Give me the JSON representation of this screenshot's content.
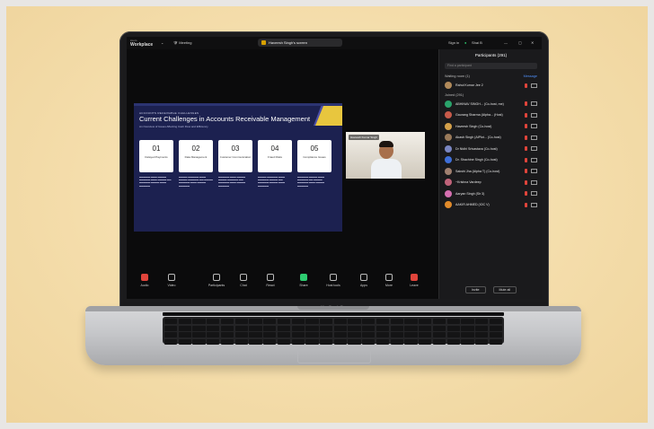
{
  "app": {
    "brand_name": "Workplace",
    "brand_sub": "zoom",
    "meeting_label": "Meeting",
    "share_title": "Haveesh Singh's screen",
    "sign_in": "Sign in",
    "host_label": "Shai B"
  },
  "slide": {
    "eyebrow": "ACCOUNTS RECEIVABLE CHALLENGES",
    "title": "Current Challenges in Accounts Receivable Management",
    "subtitle": "An Overview of Issues Affecting Cash Flow and Efficiency",
    "cards": [
      {
        "num": "01",
        "label": "Delayed Payments"
      },
      {
        "num": "02",
        "label": "Data Management"
      },
      {
        "num": "03",
        "label": "Customer Communication"
      },
      {
        "num": "04",
        "label": "Fraud Risks"
      },
      {
        "num": "05",
        "label": "Compliance Issues"
      }
    ]
  },
  "video": {
    "name": "Haveesh Kumar Singh"
  },
  "toolbar": {
    "items": [
      {
        "label": "Audio",
        "icon": "mic-muted-icon",
        "tone": "red"
      },
      {
        "label": "Video",
        "icon": "video-icon",
        "tone": ""
      },
      {
        "label": "Participants",
        "icon": "participants-icon",
        "tone": ""
      },
      {
        "label": "Chat",
        "icon": "chat-icon",
        "tone": ""
      },
      {
        "label": "React",
        "icon": "react-icon",
        "tone": ""
      },
      {
        "label": "Share",
        "icon": "share-icon",
        "tone": "green"
      },
      {
        "label": "Host tools",
        "icon": "shield-icon",
        "tone": ""
      },
      {
        "label": "Apps",
        "icon": "apps-icon",
        "tone": ""
      },
      {
        "label": "More",
        "icon": "more-icon",
        "tone": ""
      },
      {
        "label": "Leave",
        "icon": "leave-icon",
        "tone": "red"
      }
    ]
  },
  "participants": {
    "title": "Participants (291)",
    "search_placeholder": "Find a participant",
    "waiting_label": "Waiting room (1)",
    "waiting_action": "Message",
    "waiting": [
      {
        "name": "Rahul Kumar Jee 2",
        "color": "#b18a5a"
      }
    ],
    "joined_label": "Joined (291)",
    "list": [
      {
        "name": "ABHINAV SINGH... (Co-host, me)",
        "color": "#2aa36b"
      },
      {
        "name": "Gaurang Sharma (Alpha... (Host)",
        "color": "#c75a4a"
      },
      {
        "name": "Haveesh Singh (Co-host)",
        "color": "#d4a04a"
      },
      {
        "name": "Akash Singh (AlPlot... (Co-host)",
        "color": "#9a7a5a"
      },
      {
        "name": "Dr Nidhi Srivastava (Co-host)",
        "color": "#7a86c2"
      },
      {
        "name": "Dr. Shachine Singh (Co-host)",
        "color": "#3f6fd8"
      },
      {
        "name": "Sakshi Jha (Alpha T) (Co-host)",
        "color": "#a08070"
      },
      {
        "name": "~Krishna Vardeep",
        "color": "#c0637a"
      },
      {
        "name": "Aaryan Singh (Sir 3)",
        "color": "#d56fb0"
      },
      {
        "name": "AAKIR AHMED (IOC V)",
        "color": "#e08a2a"
      }
    ],
    "invite": "Invite",
    "mute_all": "Mute all"
  },
  "device": {
    "label": "MacBook Pro"
  }
}
